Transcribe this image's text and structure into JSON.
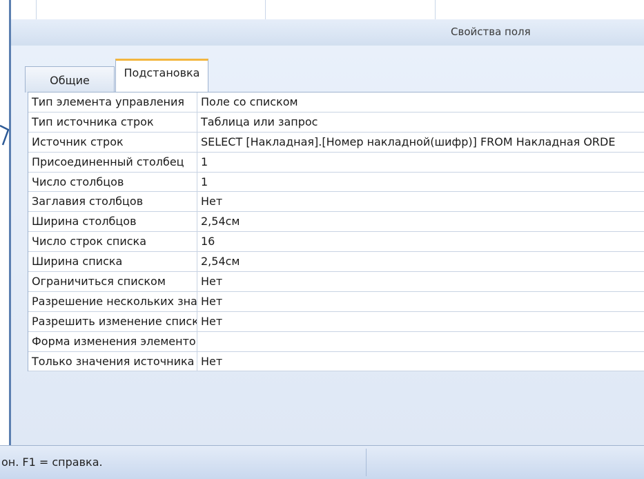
{
  "panel": {
    "title": "Свойства поля",
    "tabs": [
      {
        "label": "Общие",
        "active": false
      },
      {
        "label": "Подстановка",
        "active": true
      }
    ]
  },
  "properties": [
    {
      "name": "Тип элемента управления",
      "value": "Поле со списком"
    },
    {
      "name": "Тип источника строк",
      "value": "Таблица или запрос"
    },
    {
      "name": "Источник строк",
      "value": "SELECT [Накладная].[Номер накладной(шифр)] FROM Накладная ORDE"
    },
    {
      "name": "Присоединенный столбец",
      "value": "1"
    },
    {
      "name": "Число столбцов",
      "value": "1"
    },
    {
      "name": "Заглавия столбцов",
      "value": "Нет"
    },
    {
      "name": "Ширина столбцов",
      "value": "2,54см"
    },
    {
      "name": "Число строк списка",
      "value": "16"
    },
    {
      "name": "Ширина списка",
      "value": "2,54см"
    },
    {
      "name": "Ограничиться списком",
      "value": "Нет"
    },
    {
      "name": "Разрешение нескольких значений",
      "value": "Нет"
    },
    {
      "name": "Разрешить изменение списка значений",
      "value": "Нет"
    },
    {
      "name": "Форма изменения элементов списка",
      "value": ""
    },
    {
      "name": "Только значения источника строк",
      "value": "Нет"
    }
  ],
  "status_bar": {
    "text": "он.  F1 = справка."
  },
  "colors": {
    "tab_accent": "#f3b63f",
    "panel_bg": "#dfe8f5",
    "border": "#9fb3cf"
  }
}
